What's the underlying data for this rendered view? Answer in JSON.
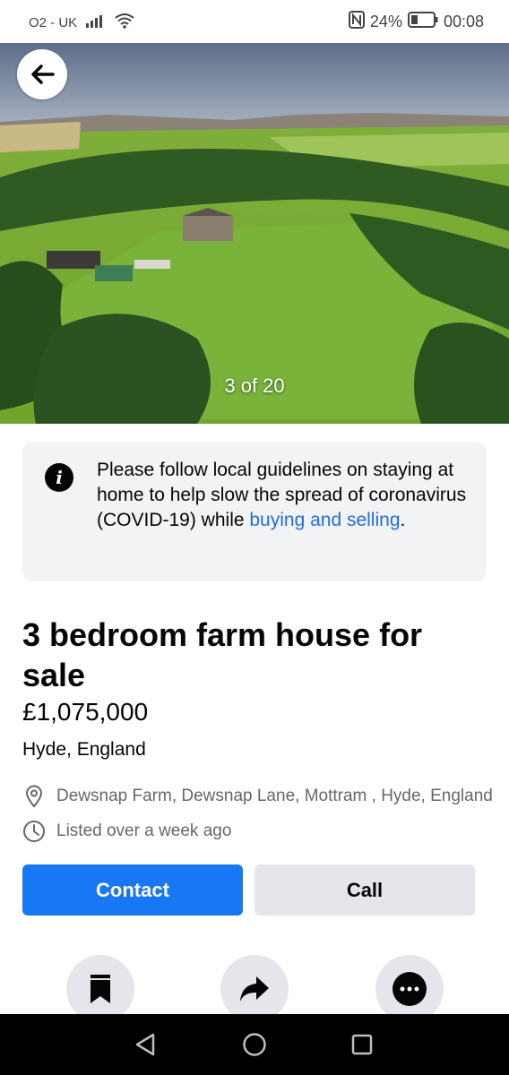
{
  "status_bar": {
    "carrier": "O2 - UK",
    "battery_percent": "24%",
    "time": "00:08",
    "icons": [
      "signal-icon",
      "wifi-icon",
      "nfc-icon",
      "battery-icon"
    ]
  },
  "hero": {
    "photo_counter": "3 of 20",
    "back_icon": "arrow-left-icon"
  },
  "notice": {
    "icon": "info-icon",
    "text_before": "Please follow local guidelines on staying at home to help slow the spread of coronavirus (COVID-19) while ",
    "link_text": "buying and selling",
    "text_after": "."
  },
  "listing": {
    "title": "3 bedroom farm house for sale",
    "price": "£1,075,000",
    "location": "Hyde, England",
    "address": "Dewsnap Farm, Dewsnap Lane, Mottram , Hyde, England",
    "listed": "Listed over a week ago"
  },
  "buttons": {
    "contact": "Contact",
    "call": "Call"
  },
  "actions": [
    "bookmark-icon",
    "share-icon",
    "more-icon"
  ],
  "nav": [
    "back-triangle-icon",
    "home-circle-icon",
    "recents-square-icon"
  ],
  "colors": {
    "primary": "#1877f2",
    "link": "#216fdb",
    "secondary_button": "#e4e6eb",
    "notice_bg": "#f2f3f5"
  }
}
